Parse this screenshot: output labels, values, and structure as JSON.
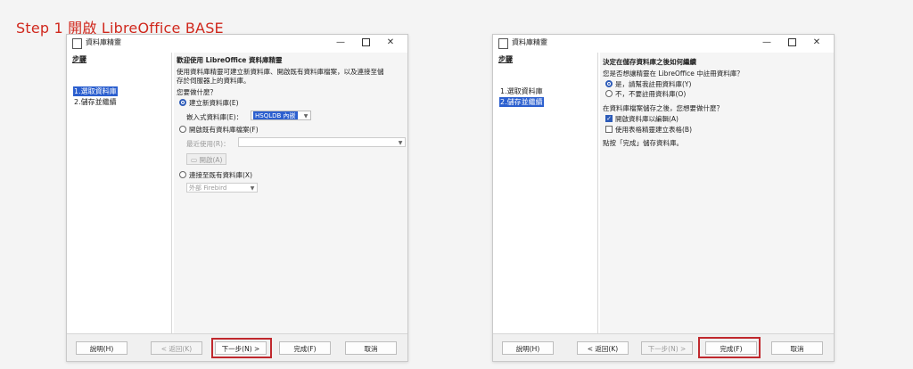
{
  "heading": "Step 1 開啟 LibreOffice BASE",
  "left_window": {
    "title": "資料庫精靈",
    "controls": {
      "minimize": "—",
      "close": "✕"
    },
    "sidebar": {
      "header": "步驟",
      "items": [
        {
          "label": "1.選取資料庫",
          "selected": true
        },
        {
          "label": "2.儲存並繼續",
          "selected": false
        }
      ]
    },
    "content": {
      "heading": "歡迎使用 LibreOffice 資料庫精靈",
      "desc_line1": "使用資料庫精靈可建立新資料庫、開啟既有資料庫檔案，以及連接至儲",
      "desc_line2": "存於伺服器上的資料庫。",
      "question": "您要做什麼？",
      "opt_create": "建立新資料庫(E)",
      "embedded_label": "嵌入式資料庫(E)：",
      "embedded_value": "HSQLDB 內嵌",
      "opt_open": "開啟既有資料庫檔案(F)",
      "recent_label": "最近使用(R)：",
      "open_button": "開啟(A)",
      "opt_connect": "連接至既有資料庫(X)",
      "connect_value": "外部 Firebird"
    },
    "footer": {
      "help": "說明(H)",
      "back": "< 返回(K)",
      "next": "下一步(N) >",
      "finish": "完成(F)",
      "cancel": "取消"
    }
  },
  "right_window": {
    "title": "資料庫精靈",
    "controls": {
      "minimize": "—",
      "close": "✕"
    },
    "sidebar": {
      "header": "步驟",
      "items": [
        {
          "label": "1.選取資料庫",
          "selected": false
        },
        {
          "label": "2.儲存並繼續",
          "selected": true
        }
      ]
    },
    "content": {
      "heading": "決定在儲存資料庫之後如何繼續",
      "register_question": "您是否想讓精靈在 LibreOffice 中註冊資料庫？",
      "opt_yes": "是，請幫我註冊資料庫(Y)",
      "opt_no": "不，不要註冊資料庫(O)",
      "after_question": "在資料庫檔案儲存之後，您想要做什麼？",
      "chk_open": "開啟資料庫以編輯(A)",
      "chk_tables": "使用表格精靈建立表格(B)",
      "finish_note": "點按「完成」儲存資料庫。"
    },
    "footer": {
      "help": "說明(H)",
      "back": "< 返回(K)",
      "next": "下一步(N) >",
      "finish": "完成(F)",
      "cancel": "取消"
    }
  },
  "colors": {
    "accent": "#2b5fcf",
    "highlight_border": "#c0282d",
    "heading": "#d0281d"
  }
}
